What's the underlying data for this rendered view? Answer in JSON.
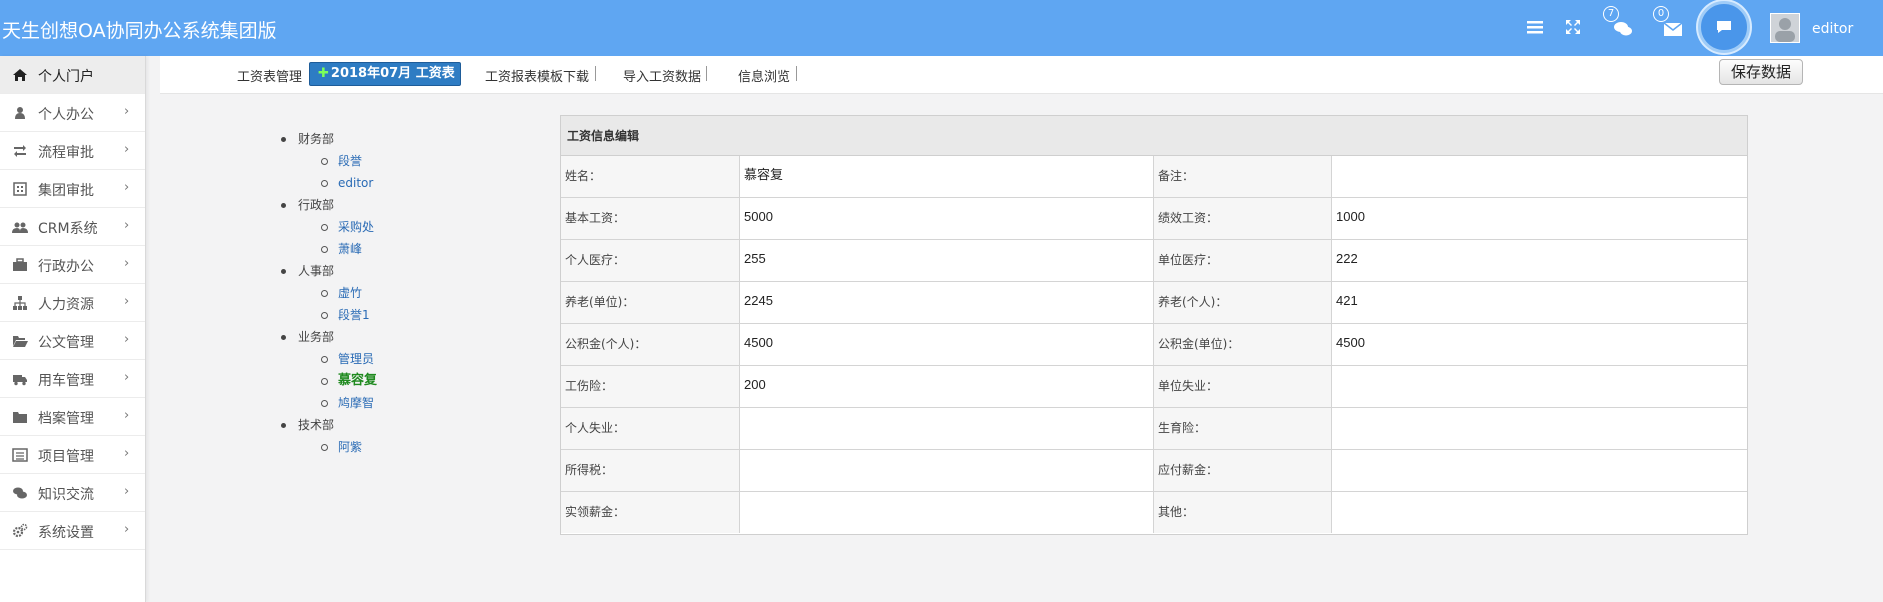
{
  "header": {
    "app_title": "天生创想OA协同办公系统集团版",
    "chat_badge": "7",
    "mail_badge": "0",
    "username": "editor",
    "icons": [
      "menu-icon",
      "fullscreen-icon",
      "chat-icon",
      "mail-icon",
      "message-icon"
    ]
  },
  "sidebar": {
    "items": [
      {
        "label": "个人门户",
        "icon": "home-icon"
      },
      {
        "label": "个人办公",
        "icon": "user-icon"
      },
      {
        "label": "流程审批",
        "icon": "retweet-icon"
      },
      {
        "label": "集团审批",
        "icon": "grid-icon"
      },
      {
        "label": "CRM系统",
        "icon": "users-icon"
      },
      {
        "label": "行政办公",
        "icon": "briefcase-icon"
      },
      {
        "label": "人力资源",
        "icon": "sitemap-icon"
      },
      {
        "label": "公文管理",
        "icon": "folder-open-icon"
      },
      {
        "label": "用车管理",
        "icon": "truck-icon"
      },
      {
        "label": "档案管理",
        "icon": "folder-icon"
      },
      {
        "label": "项目管理",
        "icon": "list-icon"
      },
      {
        "label": "知识交流",
        "icon": "comments-icon"
      },
      {
        "label": "系统设置",
        "icon": "cogs-icon"
      }
    ],
    "chevron": "›"
  },
  "toolbar": {
    "salary_mgmt": "工资表管理",
    "active_tab": "2018年07月 工资表",
    "active_plus": "✚",
    "template_download": "工资报表模板下载",
    "import_data": "导入工资数据",
    "info_browse": "信息浏览",
    "save_label": "保存数据"
  },
  "tree": [
    {
      "dept": "财务部",
      "people": [
        "段誉",
        "editor"
      ]
    },
    {
      "dept": "行政部",
      "people": [
        "采购处",
        "萧峰"
      ]
    },
    {
      "dept": "人事部",
      "people": [
        "虚竹",
        "段誉1"
      ]
    },
    {
      "dept": "业务部",
      "people": [
        "管理员",
        "慕容复",
        "鸠摩智"
      ]
    },
    {
      "dept": "技术部",
      "people": [
        "阿紫"
      ]
    }
  ],
  "selected_person": "慕容复",
  "panel": {
    "title": "工资信息编辑",
    "rows": [
      [
        "姓名：",
        "慕容复",
        "备注：",
        ""
      ],
      [
        "基本工资：",
        "5000",
        "绩效工资：",
        "1000"
      ],
      [
        "个人医疗：",
        "255",
        "单位医疗：",
        "222"
      ],
      [
        "养老(单位)：",
        "2245",
        "养老(个人)：",
        "421"
      ],
      [
        "公积金(个人)：",
        "4500",
        "公积金(单位)：",
        "4500"
      ],
      [
        "工伤险：",
        "200",
        "单位失业：",
        ""
      ],
      [
        "个人失业：",
        "",
        "生育险：",
        ""
      ],
      [
        "所得税：",
        "",
        "应付薪金：",
        ""
      ],
      [
        "实领薪金：",
        "",
        "其他：",
        ""
      ]
    ]
  }
}
